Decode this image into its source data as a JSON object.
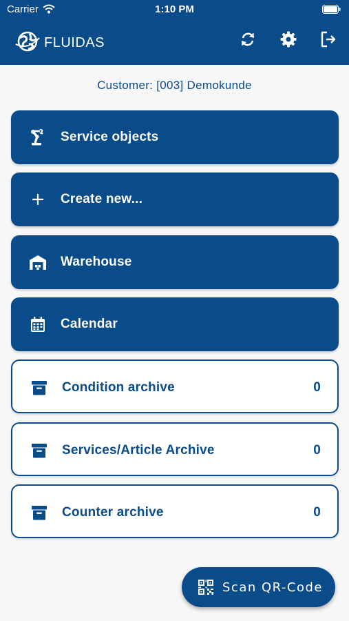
{
  "status_bar": {
    "carrier": "Carrier",
    "time": "1:10 PM"
  },
  "header": {
    "app_name": "FLUIDAS",
    "actions": [
      {
        "icon": "sync-icon"
      },
      {
        "icon": "gear-icon"
      },
      {
        "icon": "logout-icon"
      }
    ]
  },
  "customer": {
    "text": "Customer: [003] Demokunde"
  },
  "menu": [
    {
      "label": "Service objects",
      "icon": "robot-arm-icon",
      "style": "filled"
    },
    {
      "label": "Create new...",
      "icon": "plus-icon",
      "style": "filled"
    },
    {
      "label": "Warehouse",
      "icon": "warehouse-icon",
      "style": "filled"
    },
    {
      "label": "Calendar",
      "icon": "calendar-icon",
      "style": "filled"
    },
    {
      "label": "Condition archive",
      "icon": "archive-box-icon",
      "style": "outline",
      "count": "0"
    },
    {
      "label": "Services/Article Archive",
      "icon": "archive-box-icon",
      "style": "outline",
      "count": "0"
    },
    {
      "label": "Counter archive",
      "icon": "archive-box-icon",
      "style": "outline",
      "count": "0"
    }
  ],
  "fab": {
    "label": "Scan QR-Code",
    "icon": "qr-code-icon"
  },
  "colors": {
    "primary": "#0a4b8a",
    "background": "#f7f7f7",
    "surface": "#ffffff"
  }
}
